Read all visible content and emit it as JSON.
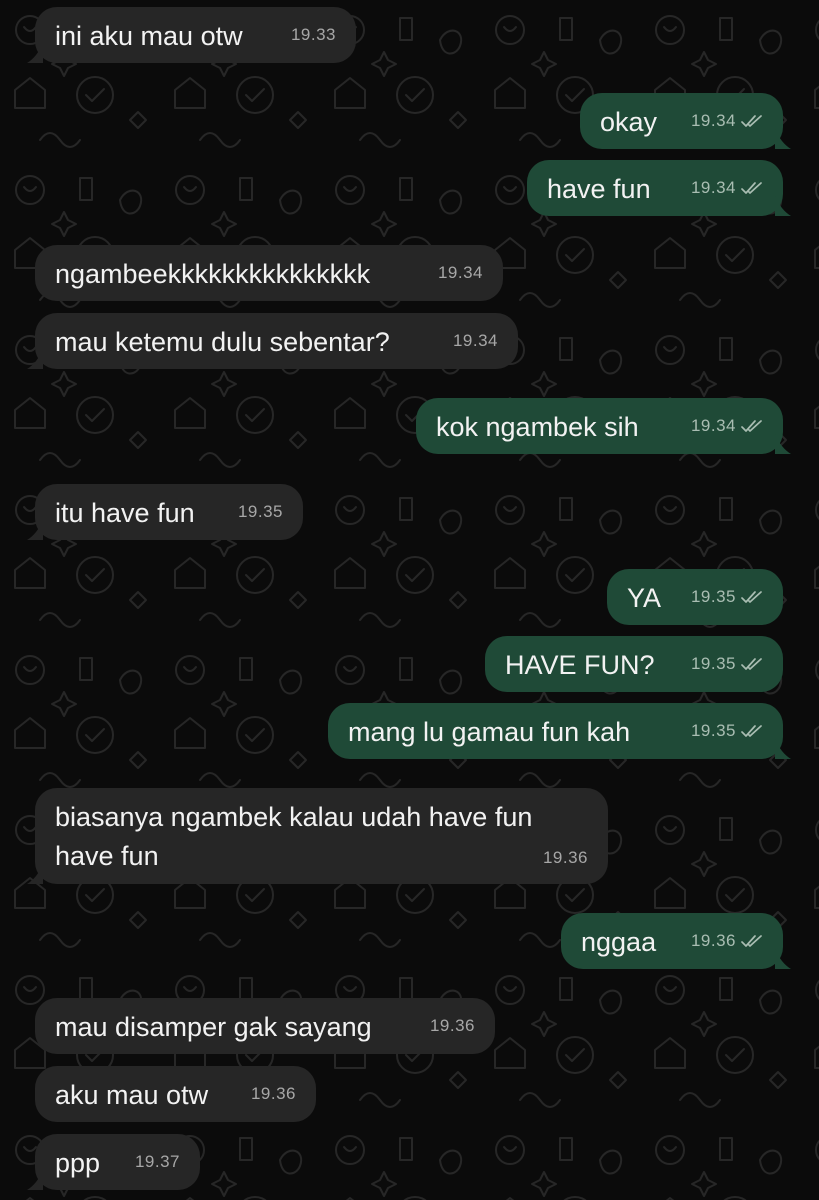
{
  "colors": {
    "background": "#0b0b0b",
    "incoming_bubble": "#262626",
    "outgoing_bubble": "#1f4a37",
    "message_text": "#f2f2f2",
    "timestamp": "#a7a7a7",
    "read_receipt": "#a9bdb2"
  },
  "messages": [
    {
      "direction": "incoming",
      "text": "ini aku mau otw",
      "time": "19.33"
    },
    {
      "direction": "outgoing",
      "text": "okay",
      "time": "19.34",
      "status_icon": "double-check-icon"
    },
    {
      "direction": "outgoing",
      "text": "have fun",
      "time": "19.34",
      "status_icon": "double-check-icon"
    },
    {
      "direction": "incoming",
      "text": "ngambeekkkkkkkkkkkkkkk",
      "time": "19.34"
    },
    {
      "direction": "incoming",
      "text": "mau ketemu dulu sebentar?",
      "time": "19.34"
    },
    {
      "direction": "outgoing",
      "text": "kok ngambek sih",
      "time": "19.34",
      "status_icon": "double-check-icon"
    },
    {
      "direction": "incoming",
      "text": "itu have fun",
      "time": "19.35"
    },
    {
      "direction": "outgoing",
      "text": "YA",
      "time": "19.35",
      "status_icon": "double-check-icon"
    },
    {
      "direction": "outgoing",
      "text": "HAVE FUN?",
      "time": "19.35",
      "status_icon": "double-check-icon"
    },
    {
      "direction": "outgoing",
      "text": "mang lu gamau fun kah",
      "time": "19.35",
      "status_icon": "double-check-icon"
    },
    {
      "direction": "incoming",
      "text_line1": "biasanya ngambek kalau udah have fun",
      "text_line2": "have fun",
      "time": "19.36"
    },
    {
      "direction": "outgoing",
      "text": "nggaa",
      "time": "19.36",
      "status_icon": "double-check-icon"
    },
    {
      "direction": "incoming",
      "text": "mau disamper gak sayang",
      "time": "19.36"
    },
    {
      "direction": "incoming",
      "text": "aku mau otw",
      "time": "19.36"
    },
    {
      "direction": "incoming",
      "text": "ppp",
      "time": "19.37"
    }
  ]
}
